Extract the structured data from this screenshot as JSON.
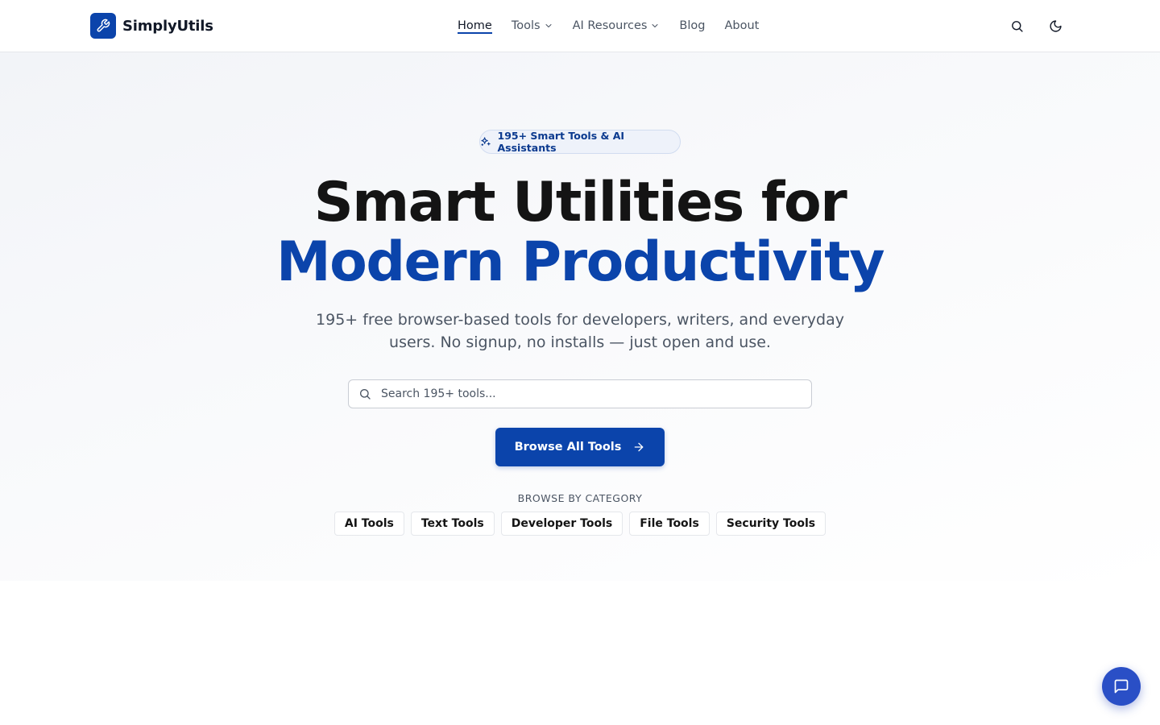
{
  "brand": {
    "name": "SimplyUtils",
    "accent": "#0b44ab"
  },
  "nav": {
    "items": [
      {
        "label": "Home",
        "active": true,
        "dropdown": false
      },
      {
        "label": "Tools",
        "active": false,
        "dropdown": true
      },
      {
        "label": "AI Resources",
        "active": false,
        "dropdown": true
      },
      {
        "label": "Blog",
        "active": false,
        "dropdown": false
      },
      {
        "label": "About",
        "active": false,
        "dropdown": false
      }
    ]
  },
  "header_actions": {
    "search_icon": "search-icon",
    "theme_icon": "moon-icon"
  },
  "hero": {
    "badge": "195+ Smart Tools & AI Assistants",
    "title_line1": "Smart Utilities for",
    "title_line2": "Modern Productivity",
    "subtitle": "195+ free browser-based tools for developers, writers, and everyday users. No signup, no installs — just open and use.",
    "search": {
      "placeholder": "Search 195+ tools...",
      "value": ""
    },
    "cta_label": "Browse All Tools",
    "browse_label": "BROWSE BY CATEGORY",
    "categories": [
      "AI Tools",
      "Text Tools",
      "Developer Tools",
      "File Tools",
      "Security Tools"
    ]
  },
  "chat": {
    "icon": "chat-icon",
    "color": "#2a4fc6"
  }
}
